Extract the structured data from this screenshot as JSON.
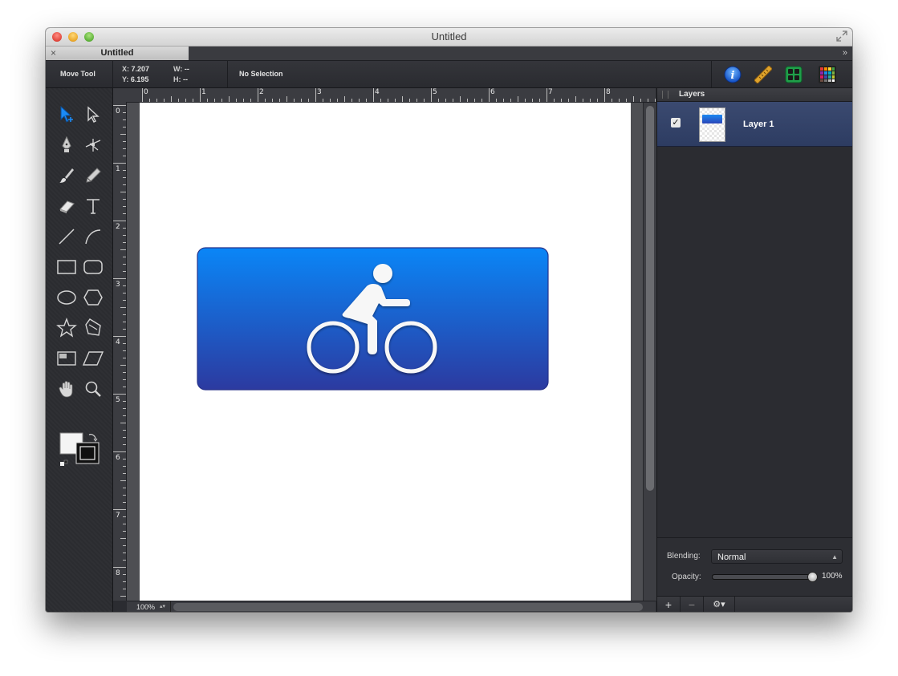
{
  "window": {
    "title": "Untitled",
    "tab_label": "Untitled",
    "tab_close": "×",
    "tab_overflow": "»"
  },
  "toolbar": {
    "tool_name": "Move Tool",
    "x_label": "X:",
    "x_value": "7.207",
    "y_label": "Y:",
    "y_value": "6.195",
    "w_label": "W:",
    "w_value": "--",
    "h_label": "H:",
    "h_value": "--",
    "selection": "No Selection",
    "icons": [
      "info-icon",
      "ruler-icon",
      "grid-layout-icon",
      "color-swatches-icon"
    ]
  },
  "tools": [
    "selection-arrow-tool",
    "direct-select-tool",
    "pen-tool",
    "node-tool",
    "brush-tool",
    "pencil-tool",
    "eraser-tool",
    "text-tool",
    "line-tool",
    "curve-tool",
    "rectangle-tool",
    "rounded-rectangle-tool",
    "ellipse-tool",
    "hexagon-tool",
    "star-tool",
    "polygon-tool",
    "crop-tool",
    "skew-tool",
    "hand-tool",
    "zoom-tool"
  ],
  "rulers": {
    "horizontal": [
      "0",
      "1",
      "2",
      "3",
      "4",
      "5",
      "6",
      "7",
      "8"
    ],
    "vertical": [
      "0",
      "1",
      "2",
      "3",
      "4",
      "5",
      "6",
      "7",
      "8"
    ]
  },
  "status": {
    "zoom": "100%"
  },
  "layers": {
    "title": "Layers",
    "items": [
      {
        "name": "Layer 1",
        "visible": true,
        "selected": true
      }
    ],
    "blending_label": "Blending:",
    "blending_value": "Normal",
    "opacity_label": "Opacity:",
    "opacity_value": "100%",
    "opacity_fraction": 1.0,
    "footer": {
      "add": "+",
      "remove": "−",
      "gear": "⚙▾"
    }
  },
  "colors": {
    "accent_blue": "#1b8bf7",
    "artwork_top": "#0a86f7",
    "artwork_bottom": "#2c3aa0",
    "selected_layer": "#34436a"
  }
}
